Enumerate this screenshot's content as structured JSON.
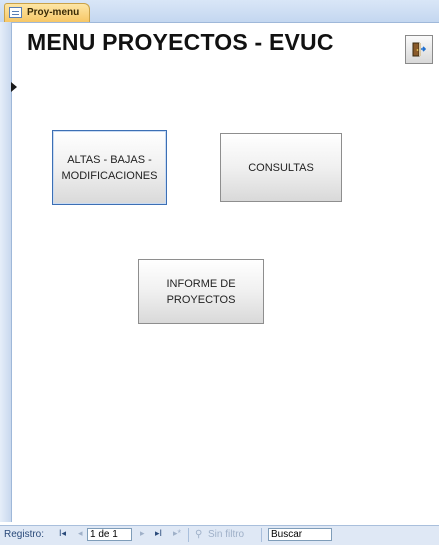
{
  "tab": {
    "label": "Proy-menu",
    "icon": "form-icon"
  },
  "title": "MENU PROYECTOS - EVUC",
  "exit_button": {
    "icon": "exit-door-icon"
  },
  "buttons": {
    "altas": "ALTAS - BAJAS -\nMODIFICACIONES",
    "consultas": "CONSULTAS",
    "informe": "INFORME DE\nPROYECTOS"
  },
  "navbar": {
    "record_label": "Registro:",
    "first_glyph": "I◂",
    "prev_glyph": "◂",
    "record_value": "1 de 1",
    "next_glyph": "▸",
    "last_glyph": "▸I",
    "new_glyph": "▸*",
    "filter_label": "Sin filtro",
    "search_label": "Buscar"
  },
  "colors": {
    "accent_tab": "#f7c766",
    "navbar_bg": "#dfe8f5",
    "focus_border": "#3c6fb4"
  }
}
